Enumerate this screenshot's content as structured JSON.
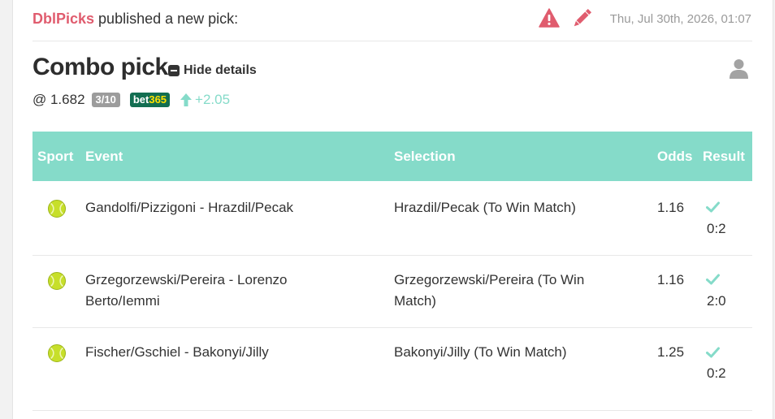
{
  "header": {
    "username": "DblPicks",
    "published_text": " published a new pick:",
    "date": "Thu, Jul 30th, 2026, 01:07",
    "icons": [
      "warning-icon",
      "pencil-icon"
    ]
  },
  "pick": {
    "title": "Combo pick",
    "toggle_label": "Hide details",
    "odds_prefix": "@ 1.682",
    "stake": "3/10",
    "bookmaker_part1": "bet",
    "bookmaker_part2": "365",
    "odds_change": "+2.05"
  },
  "colors": {
    "accent": "#85dbc9",
    "username": "#e05c6e",
    "bookmaker_bg": "#126e51",
    "warning": "#e05c6e"
  },
  "table": {
    "headers": {
      "sport": "Sport",
      "event": "Event",
      "selection": "Selection",
      "odds": "Odds",
      "result": "Result"
    },
    "rows": [
      {
        "sport": "tennis-ball-icon",
        "event": "Gandolfi/Pizzigoni - Hrazdil/Pecak",
        "selection": "Hrazdil/Pecak (To Win Match)",
        "odds": "1.16",
        "result": "0:2"
      },
      {
        "sport": "tennis-ball-icon",
        "event": "Grzegorzewski/Pereira - Lorenzo Berto/Iemmi",
        "selection": "Grzegorzewski/Pereira (To Win Match)",
        "odds": "1.16",
        "result": "2:0"
      },
      {
        "sport": "tennis-ball-icon",
        "event": "Fischer/Gschiel - Bakonyi/Jilly",
        "selection": "Bakonyi/Jilly (To Win Match)",
        "odds": "1.25",
        "result": "0:2"
      }
    ]
  }
}
